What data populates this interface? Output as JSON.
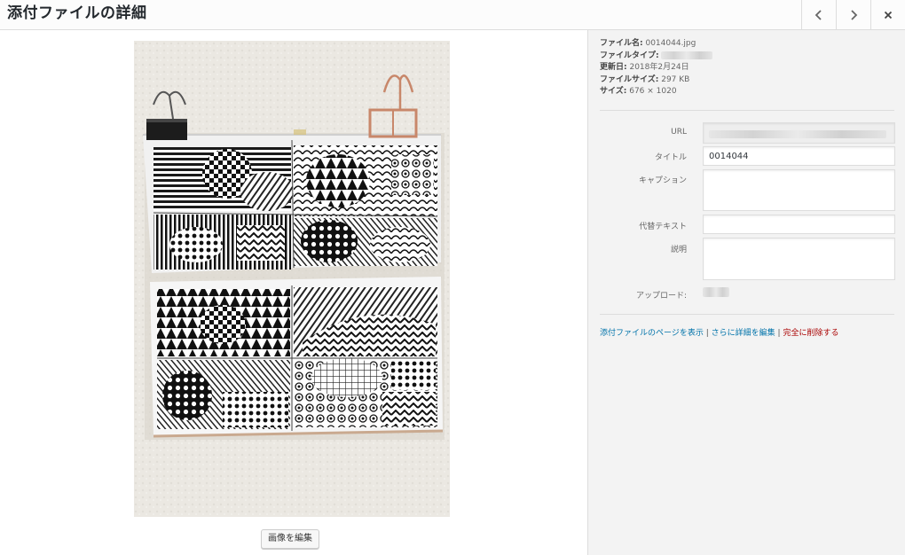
{
  "header": {
    "title": "添付ファイルの詳細",
    "prev_label": "Previous",
    "next_label": "Next",
    "close_label": "Close"
  },
  "meta": {
    "filename_label": "ファイル名:",
    "filename": "0014044.jpg",
    "filetype_label": "ファイルタイプ:",
    "updated_label": "更新日:",
    "updated": "2018年2月24日",
    "filesize_label": "ファイルサイズ:",
    "filesize": "297 KB",
    "dimensions_label": "サイズ:",
    "dimensions": "676 × 1020"
  },
  "fields": {
    "url_label": "URL",
    "title_label": "タイトル",
    "title_value": "0014044",
    "caption_label": "キャプション",
    "caption_value": "",
    "alt_label": "代替テキスト",
    "alt_value": "",
    "description_label": "説明",
    "description_value": "",
    "uploaded_by_label": "アップロード:"
  },
  "actions": {
    "view_page": "添付ファイルのページを表示",
    "edit_more": "さらに詳細を編集",
    "delete": "完全に削除する",
    "separator": "|"
  },
  "edit_image_label": "画像を編集",
  "colors": {
    "link": "#0073aa",
    "delete": "#aa0000",
    "panel_bg": "#f3f3f3"
  }
}
